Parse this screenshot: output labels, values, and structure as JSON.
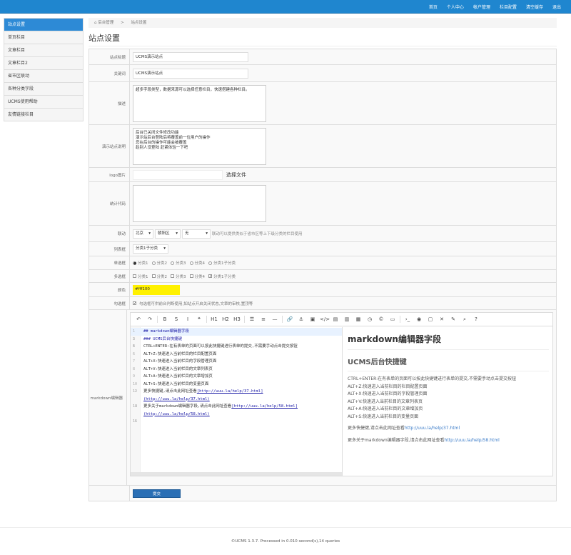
{
  "topnav": [
    "首页",
    "个人中心",
    "帐户管理",
    "栏目配置",
    "清空缓存",
    "退出"
  ],
  "sidebar": [
    "站点设置",
    "单页栏目",
    "文章栏目",
    "文章栏目2",
    "省市区联动",
    "各种分类字段",
    "UCMS使用帮助",
    "友情链接栏目"
  ],
  "breadcrumb": {
    "home_icon": "home-icon",
    "home": "后台管理",
    "sep": ">",
    "current": "站点设置"
  },
  "page_title": "站点设置",
  "form": {
    "site_title": {
      "label": "站点标题",
      "value": "UCMS演示站点"
    },
    "keywords": {
      "label": "关键词",
      "value": "UCMS演示站点"
    },
    "description": {
      "label": "描述",
      "value": "超多字段类型，数据来源可以选择任意栏目，快速搭建各种栏目。"
    },
    "demo_note": {
      "label": "演示站点说明",
      "value": "后台已关闭文件修改功能\n演示站后台登陆后将覆盖前一位用户的操作\n您在后台的操作可能会被覆盖\n趁别人没登陆 赶紧体验一下吧"
    },
    "logo": {
      "label": "logo图片",
      "button": "选择文件"
    },
    "stats": {
      "label": "统计代码",
      "value": ""
    },
    "linkage": {
      "label": "联动",
      "selects": [
        "北京",
        "朝阳区",
        "无"
      ],
      "hint": "联动可以提供类似于省市区等上下级分类的栏目使用"
    },
    "listbox": {
      "label": "列表框",
      "value": "分类1子分类"
    },
    "radio": {
      "label": "单选框",
      "options": [
        "分类1",
        "分类2",
        "分类3",
        "分类4",
        "分类1子分类"
      ],
      "selected": 0
    },
    "checkbox": {
      "label": "多选框",
      "options": [
        "分类1",
        "分类2",
        "分类3",
        "分类4",
        "分类1子分类"
      ],
      "checked": [
        4
      ]
    },
    "color": {
      "label": "颜色",
      "value": "#fff100",
      "swatch": "#fff100"
    },
    "tick": {
      "label": "勾选框",
      "checked": true,
      "text": "勾选框可供前台判断使用,如站点开启关闭状态,文章的审核,置顶等"
    },
    "markdown": {
      "label": "markdown编辑器"
    },
    "submit": "提交"
  },
  "editor": {
    "toolbar": [
      "↶",
      "↷",
      "B",
      "S",
      "I",
      "❝",
      "H1",
      "H2",
      "H3",
      "☰",
      "≡",
      "—",
      "🔗",
      "⚓",
      "▣",
      "</>",
      "▤",
      "▥",
      "▦",
      "◷",
      "©",
      "▭",
      "›_",
      "◉",
      "▢",
      "✕",
      "✎",
      "⌕",
      "?"
    ],
    "toolbar_names": [
      "undo",
      "redo",
      "bold",
      "strikethrough",
      "italic",
      "quote",
      "h1",
      "h2",
      "h3",
      "unordered-list",
      "ordered-list",
      "horizontal-rule",
      "link",
      "anchor",
      "image",
      "code",
      "code-block",
      "preformatted",
      "table",
      "datetime",
      "emoji",
      "html-entities",
      "goto-line",
      "watch",
      "preview",
      "fullscreen",
      "clear",
      "search",
      "help"
    ],
    "lines": [
      {
        "n": "1",
        "text": "## markdown编辑器字段",
        "h": true
      },
      {
        "n": "2",
        "text": ""
      },
      {
        "n": "3",
        "text": "### UCMS后台快捷键",
        "h": true
      },
      {
        "n": "4",
        "text": ""
      },
      {
        "n": "5",
        "text": "CTRL+ENTER:在有表单的页面可以按此快捷键进行表单的提交,不需要手动点击提交按钮"
      },
      {
        "n": "6",
        "text": "ALT+Z:快速进入当前栏目的栏目配置页面"
      },
      {
        "n": "7",
        "text": "ALT+X:快速进入当前栏目的字段管理页面"
      },
      {
        "n": "8",
        "text": "ALT+V:快速进入当前栏目的文章列表页"
      },
      {
        "n": "9",
        "text": "ALT+A:快速进入当前栏目的文章增加页"
      },
      {
        "n": "10",
        "text": "ALT+S:快速进入当前栏目的变量页面"
      },
      {
        "n": "11",
        "text": ""
      },
      {
        "n": "12",
        "text": "更多快捷键,请点击此网址查看",
        "link": "[http://uuu.la/help/37.html]",
        "cont": "(http://uuu.la/help/37.html)"
      },
      {
        "n": "13",
        "text": ""
      },
      {
        "n": "14",
        "text": "更多关于markdown编辑器字段,请点击此网址查看",
        "link": "[http://uuu.la/help/58.html]",
        "cont": "(http://uuu.la/help/58.html)"
      },
      {
        "n": "15",
        "text": ""
      },
      {
        "n": "16",
        "text": ""
      }
    ],
    "preview": {
      "h1": "markdown编辑器字段",
      "h3": "UCMS后台快捷键",
      "lines": [
        "CTRL+ENTER:在有表单的页面可以按此快捷键进行表单的提交,不需要手动点击提交按钮",
        "ALT+Z:快速进入当前栏目的栏目配置页面",
        "ALT+X:快速进入当前栏目的字段管理页面",
        "ALT+V:快速进入当前栏目的文章列表页",
        "ALT+A:快速进入当前栏目的文章增加页",
        "ALT+S:快速进入当前栏目的变量页面"
      ],
      "more1": "更多快捷键,请点击此网址查看",
      "link1": "http://uuu.la/help/37.html",
      "more2": "更多关于markdown编辑器字段,请点击此网址查看",
      "link2": "http://uuu.la/help/58.html"
    }
  },
  "footer": "©UCMS 1.3.7. Processed in 0.010 second(s),14 queries"
}
